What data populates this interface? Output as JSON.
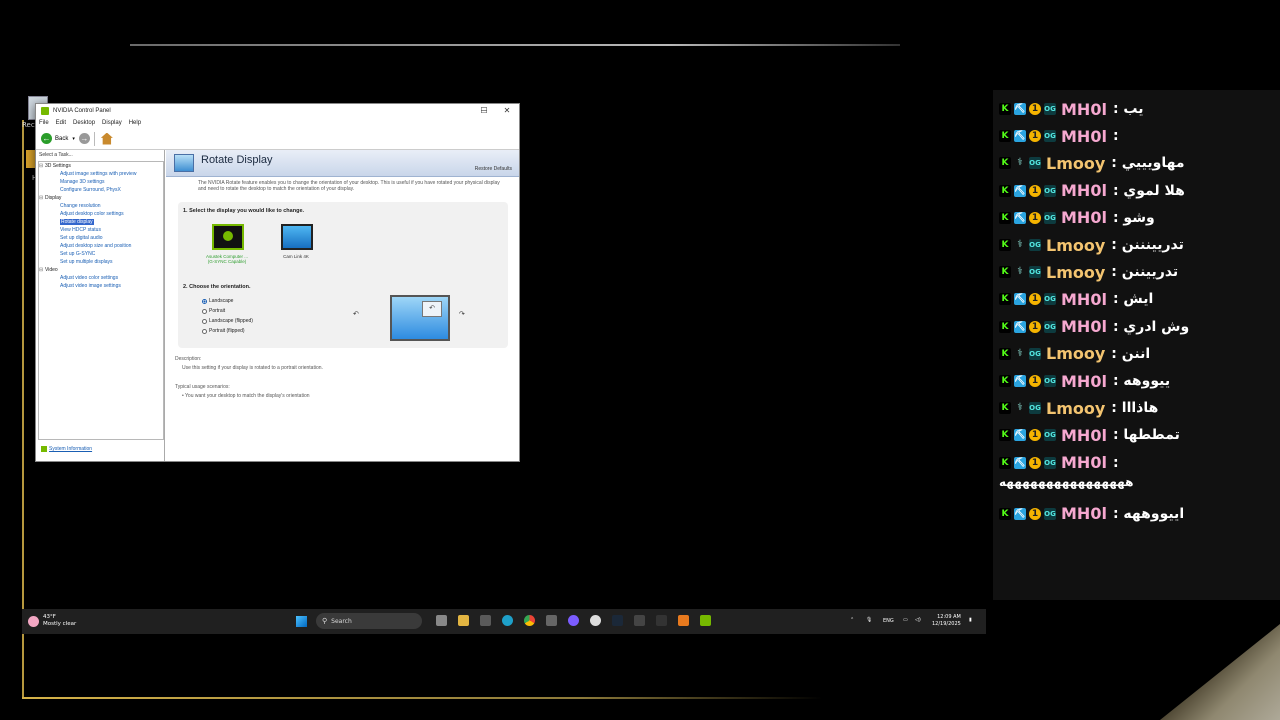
{
  "desktop": {
    "recycle_label": "Recy",
    "folder_label": "H"
  },
  "window": {
    "title": "NVIDIA Control Panel",
    "controls": {
      "minimize": "─",
      "maximize": "☐",
      "close": "✕"
    },
    "menu": [
      "File",
      "Edit",
      "Desktop",
      "Display",
      "Help"
    ],
    "toolbar": {
      "back_label": "Back"
    },
    "sidebar": {
      "header": "Select a Task...",
      "tree": [
        {
          "type": "cat",
          "label": "3D Settings"
        },
        {
          "type": "item",
          "label": "Adjust image settings with preview"
        },
        {
          "type": "item",
          "label": "Manage 3D settings"
        },
        {
          "type": "item",
          "label": "Configure Surround, PhysX"
        },
        {
          "type": "cat",
          "label": "Display"
        },
        {
          "type": "item",
          "label": "Change resolution"
        },
        {
          "type": "item",
          "label": "Adjust desktop color settings"
        },
        {
          "type": "item",
          "label": "Rotate display",
          "selected": true
        },
        {
          "type": "item",
          "label": "View HDCP status"
        },
        {
          "type": "item",
          "label": "Set up digital audio"
        },
        {
          "type": "item",
          "label": "Adjust desktop size and position"
        },
        {
          "type": "item",
          "label": "Set up G-SYNC"
        },
        {
          "type": "item",
          "label": "Set up multiple displays"
        },
        {
          "type": "cat",
          "label": "Video"
        },
        {
          "type": "item",
          "label": "Adjust video color settings"
        },
        {
          "type": "item",
          "label": "Adjust video image settings"
        }
      ],
      "system_info": "System Information"
    },
    "content": {
      "title": "Rotate Display",
      "restore_defaults": "Restore Defaults",
      "description": "The NVIDIA Rotate feature enables you to change the orientation of your desktop. This is useful if you have rotated your physical display and need to rotate the desktop to match the orientation of your display.",
      "step1": "1. Select the display you would like to change.",
      "display1": {
        "name": "Asustek Computer ...",
        "sub": "(G-SYNC Capable)"
      },
      "display2": {
        "name": "Cam Link 4K"
      },
      "step2": "2. Choose the orientation.",
      "orientations": [
        {
          "label": "Landscape",
          "checked": true
        },
        {
          "label": "Portrait",
          "checked": false
        },
        {
          "label": "Landscape (flipped)",
          "checked": false
        },
        {
          "label": "Portrait (flipped)",
          "checked": false
        }
      ],
      "rotate_left": "↶",
      "rotate_right": "↷",
      "description_hdr": "Description:",
      "description_text": "Use this setting if your display is rotated to a portrait orientation.",
      "scenarios_hdr": "Typical usage scenarios:",
      "scenario_1": "• You want your desktop to match the display's orientation"
    }
  },
  "taskbar": {
    "weather_temp": "43°F",
    "weather_cond": "Mostly clear",
    "search": "Search",
    "tray_lang": "ENG",
    "time": "12:09 AM",
    "date": "12/19/2025"
  },
  "chat": [
    {
      "user": "MH0l",
      "text": ": يب",
      "badges": [
        "k",
        "pick",
        "coin",
        "og"
      ],
      "color": "#f6a8d0"
    },
    {
      "user": "MH0l",
      "text": ":",
      "badges": [
        "k",
        "pick",
        "coin",
        "og"
      ],
      "color": "#f6a8d0"
    },
    {
      "user": "Lmooy",
      "text": ": مهاويييي",
      "badges": [
        "k",
        "wave",
        "og"
      ],
      "color": "#f3c470"
    },
    {
      "user": "MH0l",
      "text": ": هلا لموي",
      "badges": [
        "k",
        "pick",
        "coin",
        "og"
      ],
      "color": "#f6a8d0"
    },
    {
      "user": "MH0l",
      "text": ": وشو",
      "badges": [
        "k",
        "pick",
        "coin",
        "og"
      ],
      "color": "#f6a8d0"
    },
    {
      "user": "Lmooy",
      "text": ": تدريينننن",
      "badges": [
        "k",
        "wave",
        "og"
      ],
      "color": "#f3c470"
    },
    {
      "user": "Lmooy",
      "text": ": تدرييننن",
      "badges": [
        "k",
        "wave",
        "og"
      ],
      "color": "#f3c470"
    },
    {
      "user": "MH0l",
      "text": ": ايش",
      "badges": [
        "k",
        "pick",
        "coin",
        "og"
      ],
      "color": "#f6a8d0"
    },
    {
      "user": "MH0l",
      "text": ": وش ادري",
      "badges": [
        "k",
        "pick",
        "coin",
        "og"
      ],
      "color": "#f6a8d0"
    },
    {
      "user": "Lmooy",
      "text": ": اننن",
      "badges": [
        "k",
        "wave",
        "og"
      ],
      "color": "#f3c470"
    },
    {
      "user": "MH0l",
      "text": ": ييووهه",
      "badges": [
        "k",
        "pick",
        "coin",
        "og"
      ],
      "color": "#f6a8d0"
    },
    {
      "user": "Lmooy",
      "text": ": هاذااا",
      "badges": [
        "k",
        "wave",
        "og"
      ],
      "color": "#f3c470"
    },
    {
      "user": "MH0l",
      "text": ": تمططها",
      "badges": [
        "k",
        "pick",
        "coin",
        "og"
      ],
      "color": "#f6a8d0"
    },
    {
      "user": "MH0l",
      "text": ":",
      "badges": [
        "k",
        "pick",
        "coin",
        "og"
      ],
      "color": "#f6a8d0"
    },
    {
      "user": "MH0l",
      "text": ": اييووههه",
      "badges": [
        "k",
        "pick",
        "coin",
        "og"
      ],
      "color": "#f6a8d0"
    }
  ],
  "chat_continuation": "ههههههههههههههههه"
}
